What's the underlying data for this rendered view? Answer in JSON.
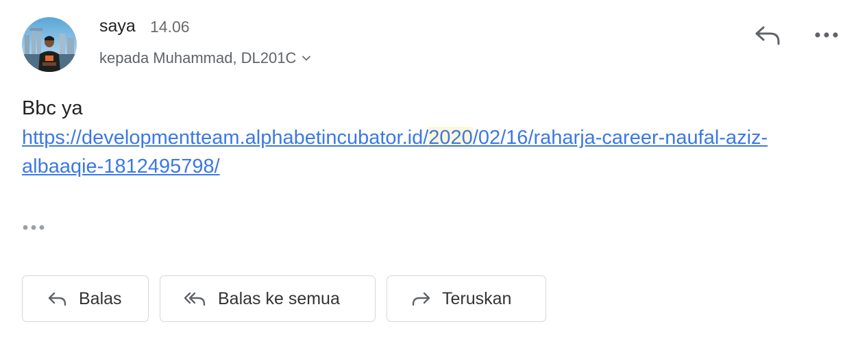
{
  "message": {
    "sender": "saya",
    "time": "14.06",
    "recipients": "kepada Muhammad, DL201C",
    "body_line": "Bbc ya",
    "link": {
      "part1": "https://developmentteam.alphabetincubator.id/",
      "highlight": "2020",
      "part2": "/02/16/raharja-career-naufal-aziz-albaaqie-1812495798/"
    }
  },
  "actions": {
    "reply": "Balas",
    "reply_all": "Balas ke semua",
    "forward": "Teruskan"
  },
  "icons": {
    "avatar": "user-avatar",
    "reply": "reply-icon",
    "more": "more-horizontal-icon",
    "expand": "chevron-down-icon",
    "reply_all": "reply-all-icon",
    "forward": "forward-icon"
  },
  "colors": {
    "link": "#3b78e7",
    "highlight": "#fdf6d8",
    "muted": "#6b6b6b",
    "border": "#d6d6d6"
  }
}
